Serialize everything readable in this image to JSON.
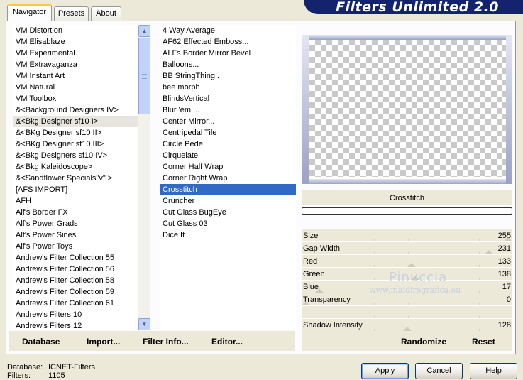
{
  "banner": {
    "title": "Filters Unlimited 2.0"
  },
  "tabs": [
    {
      "label": "Navigator",
      "active": true
    },
    {
      "label": "Presets",
      "active": false
    },
    {
      "label": "About",
      "active": false
    }
  ],
  "categories": {
    "items": [
      "VM Distortion",
      "VM Elisablaze",
      "VM Experimental",
      "VM Extravaganza",
      "VM Instant Art",
      "VM Natural",
      "VM Toolbox",
      "&<Background Designers IV>",
      "&<Bkg Designer sf10 I>",
      "&<BKg Designer sf10 II>",
      "&<BKg Designer sf10 III>",
      "&<Bkg Designers sf10 IV>",
      "&<Bkg Kaleidoscope>",
      "&<Sandflower Specials\"v\" >",
      "[AFS IMPORT]",
      "AFH",
      "Alf's Border FX",
      "Alf's Power Grads",
      "Alf's Power Sines",
      "Alf's Power Toys",
      "Andrew's Filter Collection 55",
      "Andrew's Filter Collection 56",
      "Andrew's Filter Collection 58",
      "Andrew's Filter Collection 59",
      "Andrew's Filter Collection 61",
      "Andrew's Filters 10",
      "Andrew's Filters 12"
    ],
    "highlighted_index": 8
  },
  "filters": {
    "items": [
      "4 Way Average",
      "AF62 Effected Emboss...",
      "ALFs Border Mirror Bevel",
      "Balloons...",
      "BB StringThing..",
      "bee morph",
      "BlindsVertical",
      "Blur 'em!...",
      "Center Mirror...",
      "Centripedal Tile",
      "Circle Pede",
      "Cirquelate",
      "Corner Half Wrap",
      "Corner Right Wrap",
      "Crosstitch",
      "Cruncher",
      "Cut Glass  BugEye",
      "Cut Glass 03",
      "Dice It"
    ],
    "selected_index": 14
  },
  "scroll": {
    "up_icon": "arrow-up",
    "down_icon": "arrow-down"
  },
  "preview": {
    "filter_name": "Crosstitch",
    "progress": 0
  },
  "params": [
    {
      "name": "Size",
      "value": "255",
      "level": 1.0
    },
    {
      "name": "Gap Width",
      "value": "231",
      "level": 0.906
    },
    {
      "name": "Red",
      "value": "133",
      "level": 0.522
    },
    {
      "name": "Green",
      "value": "138",
      "level": 0.541
    },
    {
      "name": "Blue",
      "value": "17",
      "level": 0.067
    },
    {
      "name": "Transparency",
      "value": "0",
      "level": 0.0
    },
    {
      "name": "",
      "value": "",
      "level": null
    },
    {
      "name": "Shadow Intensity",
      "value": "128",
      "level": 0.502
    }
  ],
  "bottom_buttons": {
    "database": "Database",
    "import": "Import...",
    "filter_info": "Filter Info...",
    "editor": "Editor..."
  },
  "randomize": "Randomize",
  "reset": "Reset",
  "watermark": {
    "line1": "Pinuccia",
    "line2": "www.maidiregrafica.eu"
  },
  "info": {
    "database_label": "Database:",
    "database_value": "ICNET-Filters",
    "filters_label": "Filters:",
    "filters_value": "1105"
  },
  "dialog_buttons": {
    "apply": "Apply",
    "cancel": "Cancel",
    "help": "Help"
  }
}
